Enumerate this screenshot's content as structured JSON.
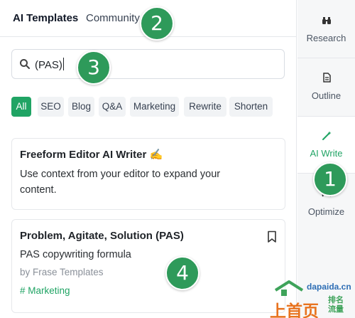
{
  "tabs": [
    {
      "label": "AI Templates",
      "active": true
    },
    {
      "label": "Community",
      "active": false
    }
  ],
  "search": {
    "value": "(PAS)",
    "icon": "search-icon"
  },
  "filters": [
    {
      "label": "All",
      "active": true
    },
    {
      "label": "SEO",
      "active": false
    },
    {
      "label": "Blog",
      "active": false
    },
    {
      "label": "Q&A",
      "active": false
    },
    {
      "label": "Marketing",
      "active": false
    },
    {
      "label": "Rewrite",
      "active": false
    },
    {
      "label": "Shorten",
      "active": false
    }
  ],
  "cards": [
    {
      "title": "Freeform Editor AI Writer ✍️",
      "description": "Use context from your editor to expand your content."
    },
    {
      "title": "Problem, Agitate, Solution (PAS)",
      "description": "PAS copywriting formula",
      "author": "by Frase Templates",
      "tag": "# Marketing",
      "bookmark_icon": "bookmark-icon"
    }
  ],
  "sidebar": {
    "items": [
      {
        "label": "Research",
        "icon": "binoculars-icon",
        "active": false
      },
      {
        "label": "Outline",
        "icon": "document-icon",
        "active": false
      },
      {
        "label": "AI Write",
        "icon": "magic-wand-icon",
        "active": true
      },
      {
        "label": "Optimize",
        "icon": "gauge-icon",
        "active": false
      }
    ]
  },
  "annotations": [
    "1",
    "2",
    "3",
    "4"
  ],
  "watermark": {
    "url": "dapaida.cn",
    "text_main": "上首页",
    "text_side": "排名流量"
  },
  "colors": {
    "accent": "#20a464",
    "badge": "#2e9a5a",
    "sidebar_bg": "#f6f7f8",
    "chip_bg": "#f1f3f5",
    "border": "#e5e7eb"
  }
}
